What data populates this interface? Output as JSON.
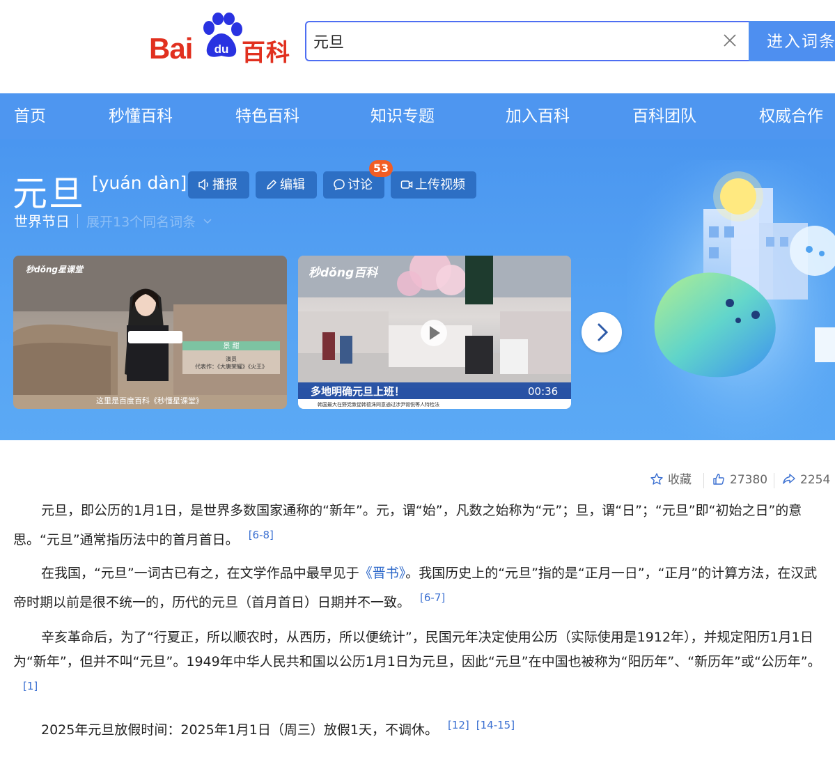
{
  "header": {
    "logo_text_bai": "Bai",
    "logo_text_du": "du",
    "logo_text_baike": "百科",
    "search_value": "元旦",
    "enter_button": "进入词条",
    "clear_icon": "close-icon"
  },
  "nav": {
    "items": [
      {
        "label": "首页"
      },
      {
        "label": "秒懂百科"
      },
      {
        "label": "特色百科"
      },
      {
        "label": "知识专题"
      },
      {
        "label": "加入百科"
      },
      {
        "label": "百科团队"
      },
      {
        "label": "权威合作"
      }
    ]
  },
  "entry": {
    "title": "元旦",
    "pinyin": "[yuán dàn]",
    "actions": {
      "broadcast": "播报",
      "edit": "编辑",
      "discuss": "讨论",
      "discuss_count": "53",
      "upload_video": "上传视频"
    },
    "category": "世界节日",
    "expand_same_name": "展开13个同名词条"
  },
  "videos": [
    {
      "brand": "秒dǒng星课堂",
      "name_tag": "景 甜",
      "role": "演员",
      "works": "代表作：《大唐荣耀》《火王》",
      "subtitle": "这里是百度百科《秒懂星课堂》"
    },
    {
      "brand": "秒dǒng百科",
      "caption": "多地明确元旦上班！",
      "duration": "00:36",
      "ticker": "韩国最大在野党敦促韩德洙同意通过涉尹锡悦等人特检法"
    }
  ],
  "toolbar": {
    "favorite": "收藏",
    "likes": "27380",
    "shares": "2254"
  },
  "content": {
    "p1": "元旦，即公历的1月1日，是世界多数国家通称的“新年”。元，谓“始”，凡数之始称为“元”；旦，谓“日”；“元旦”即“初始之日”的意思。“元旦”通常指历法中的首月首日。",
    "p1_cite": "[6-8]",
    "p2_a": "在我国，“元旦”一词古已有之，在文学作品中最早见于",
    "p2_link": "《晋书》",
    "p2_b": "。我国历史上的“元旦”指的是“正月一日”，“正月”的计算方法，在汉武帝时期以前是很不统一的，历代的元旦（首月首日）日期并不一致。",
    "p2_cite": "[6-7]",
    "p3": "辛亥革命后，为了“行夏正，所以顺农时，从西历，所以便统计”，民国元年决定使用公历（实际使用是1912年），并规定阳历1月1日为“新年”，但并不叫“元旦”。1949年中华人民共和国以公历1月1日为元旦，因此“元旦”在中国也被称为“阳历年”、“新历年”或“公历年”。",
    "p3_cite": "[1]",
    "p4": "2025年元旦放假时间：2025年1月1日（周三）放假1天，不调休。",
    "p4_cite1": "[12]",
    "p4_cite2": "[14-15]"
  },
  "colors": {
    "brand_red": "#e1301f",
    "brand_blue": "#2932e1",
    "nav_blue": "#4e96f0",
    "link_blue": "#2a66c9",
    "badge_orange": "#f25d24"
  }
}
